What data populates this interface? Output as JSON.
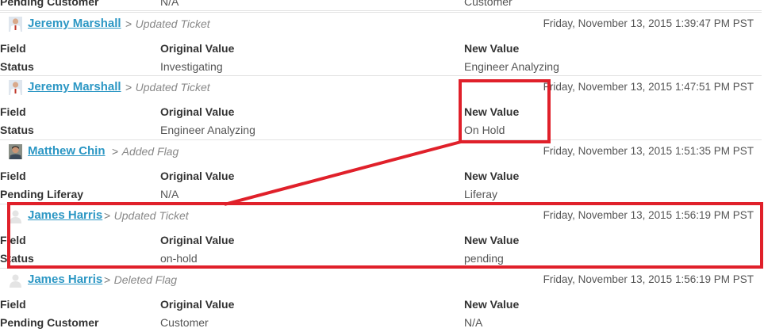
{
  "top_row": {
    "field": "Pending Customer",
    "original": "N/A",
    "new": "Customer"
  },
  "column_headers": {
    "field": "Field",
    "original": "Original Value",
    "new": "New Value"
  },
  "entries": [
    {
      "author": "Jeremy Marshall",
      "separator": ">",
      "action": "Updated Ticket",
      "date": "Friday, November 13, 2015 1:39:47 PM PST",
      "row": {
        "field": "Status",
        "original": "Investigating",
        "new": "Engineer Analyzing"
      }
    },
    {
      "author": "Jeremy Marshall",
      "separator": ">",
      "action": "Updated Ticket",
      "date": "Friday, November 13, 2015 1:47:51 PM PST",
      "row": {
        "field": "Status",
        "original": "Engineer Analyzing",
        "new": "On Hold"
      }
    },
    {
      "author": "Matthew Chin",
      "separator": ">",
      "action": "Added Flag",
      "date": "Friday, November 13, 2015 1:51:35 PM PST",
      "row": {
        "field": "Pending Liferay",
        "original": "N/A",
        "new": "Liferay"
      }
    },
    {
      "author": "James Harris",
      "separator": ">",
      "action": "Updated Ticket",
      "date": "Friday, November 13, 2015 1:56:19 PM PST",
      "row": {
        "field": "Status",
        "original": "on-hold",
        "new": "pending"
      }
    },
    {
      "author": "James Harris",
      "separator": ">",
      "action": "Deleted Flag",
      "date": "Friday, November 13, 2015 1:56:19 PM PST",
      "row": {
        "field": "Pending Customer",
        "original": "Customer",
        "new": "N/A"
      }
    }
  ],
  "colors": {
    "link": "#2c97c4",
    "annotation_red": "#e0202a"
  },
  "icons": {
    "avatar_photo": "user-photo-icon",
    "avatar_default": "default-user-icon"
  }
}
